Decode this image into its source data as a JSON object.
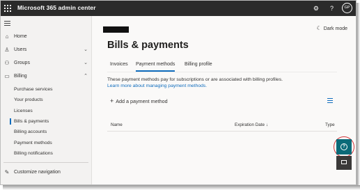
{
  "topbar": {
    "app_title": "Microsoft 365 admin center",
    "avatar_initials": "GP",
    "bg_color": "#2b2b2b"
  },
  "sidebar": {
    "items": [
      {
        "label": "Home",
        "icon": "home-icon"
      },
      {
        "label": "Users",
        "icon": "person-icon",
        "expandable": true
      },
      {
        "label": "Groups",
        "icon": "groups-icon",
        "expandable": true
      },
      {
        "label": "Billing",
        "icon": "billing-icon",
        "expanded": true
      }
    ],
    "billing_subitems": [
      {
        "label": "Purchase services"
      },
      {
        "label": "Your products"
      },
      {
        "label": "Licenses"
      },
      {
        "label": "Bills & payments",
        "active": true
      },
      {
        "label": "Billing accounts"
      },
      {
        "label": "Payment methods"
      },
      {
        "label": "Billing notifications"
      }
    ],
    "customize_label": "Customize navigation"
  },
  "main": {
    "dark_mode_label": "Dark mode",
    "page_title": "Bills & payments",
    "tabs": [
      {
        "label": "Invoices"
      },
      {
        "label": "Payment methods",
        "active": true
      },
      {
        "label": "Billing profile"
      }
    ],
    "description": "These payment methods pay for subscriptions or are associated with billing profiles.",
    "learn_more": "Learn more about managing payment methods.",
    "add_button": "Add a payment method",
    "table_headers": {
      "name": "Name",
      "expiration": "Expiration Date",
      "type": "Type"
    },
    "accent_color": "#0f6cbd"
  }
}
